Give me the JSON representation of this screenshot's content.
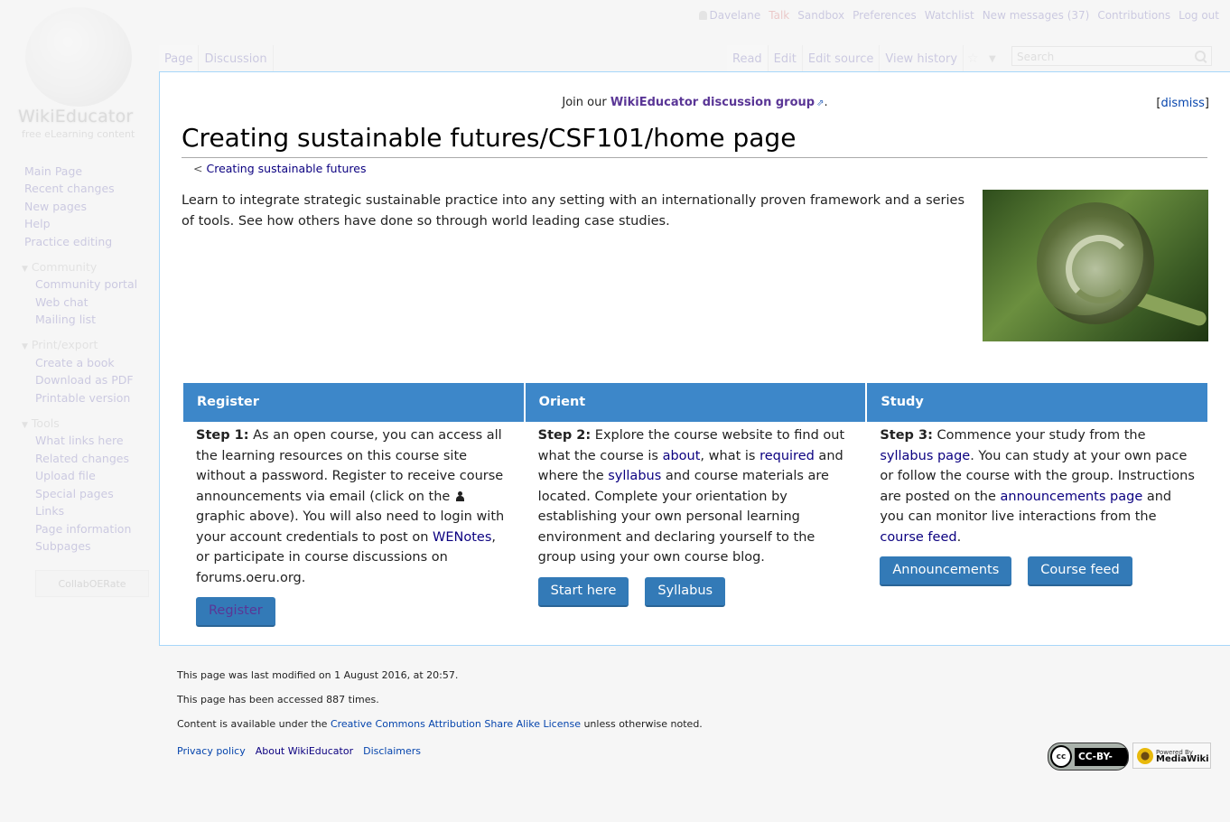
{
  "logo": {
    "wordmark": "WikiEducator",
    "tagline": "free eLearning content"
  },
  "personal": [
    {
      "label": "Davelane",
      "kind": "user"
    },
    {
      "label": "Talk",
      "kind": "talk"
    },
    {
      "label": "Sandbox"
    },
    {
      "label": "Preferences"
    },
    {
      "label": "Watchlist"
    },
    {
      "label": "New messages (37)"
    },
    {
      "label": "Contributions"
    },
    {
      "label": "Log out"
    }
  ],
  "tabs": {
    "left": [
      "Page",
      "Discussion"
    ],
    "right": [
      "Read",
      "Edit",
      "Edit source",
      "View history"
    ],
    "star_glyph": "☆",
    "more_glyph": "▼"
  },
  "search": {
    "placeholder": "Search"
  },
  "sidebar": {
    "main": [
      "Main Page",
      "Recent changes",
      "New pages",
      "Help",
      "Practice editing"
    ],
    "portals": [
      {
        "heading": "Community",
        "items": [
          "Community portal",
          "Web chat",
          "Mailing list"
        ]
      },
      {
        "heading": "Print/export",
        "items": [
          "Create a book",
          "Download as PDF",
          "Printable version"
        ]
      },
      {
        "heading": "Tools",
        "items": [
          "What links here",
          "Related changes",
          "Upload file",
          "Special pages",
          "Links",
          "Page information",
          "Subpages"
        ]
      }
    ],
    "collab_button": "CollabOERate"
  },
  "sitenotice": {
    "prefix": "Join our ",
    "link": "WikiEducator discussion group",
    "suffix": ".",
    "dismiss": "dismiss"
  },
  "page": {
    "title": "Creating sustainable futures/CSF101/home page",
    "subpage_sep": "<",
    "subpage_link": "Creating sustainable futures",
    "intro": "Learn to integrate strategic sustainable practice into any setting with an internationally proven framework and a series of tools. See how others have done so through world leading case studies."
  },
  "columns": {
    "register": {
      "heading": "Register",
      "step": "Step 1:",
      "t1": " As an open course, you can access all the learning resources on this course site without a password. Register to receive course announcements via email (click on the ",
      "t2": " graphic above). You will also need to login with your account credentials to post on ",
      "wenotes": "WENotes",
      "t3": ", or participate in course discussions on forums.oeru.org.",
      "button": "Register"
    },
    "orient": {
      "heading": "Orient",
      "step": "Step 2:",
      "t1": " Explore the course website to find out what the course is ",
      "about": "about",
      "t2": ", what is ",
      "required": "required",
      "t3": " and where the ",
      "syllabus": "syllabus",
      "t4": " and course materials are located. Complete your orientation by establishing your own personal learning environment and declaring yourself to the group using your own course blog.",
      "button1": "Start here",
      "button2": "Syllabus"
    },
    "study": {
      "heading": "Study",
      "step": "Step 3:",
      "t1": " Commence your study from the ",
      "syllabus_page": "syllabus page",
      "t2": ". You can study at your own pace or follow the course with the group. Instructions are posted on the ",
      "announcements_page": "announcements page",
      "t3": " and you can monitor live interactions from the ",
      "course_feed": "course feed",
      "t4": ".",
      "button1": "Announcements",
      "button2": "Course feed"
    }
  },
  "footer": {
    "lastmod": "This page was last modified on 1 August 2016, at 20:57.",
    "views": "This page has been accessed 887 times.",
    "license_prefix": "Content is available under the ",
    "license_link": "Creative Commons Attribution Share Alike License",
    "license_suffix": " unless otherwise noted.",
    "places": [
      "Privacy policy",
      "About WikiEducator",
      "Disclaimers"
    ],
    "cc_badge": {
      "circle": "cc",
      "text": "CC-BY-SA"
    },
    "mw_badge": {
      "line1": "Powered By",
      "line2": "MediaWiki"
    }
  },
  "colors": {
    "accent": "#3d87c9",
    "button": "#337ab7",
    "link": "#0b0080",
    "visited": "#5a3696",
    "border": "#a7d7f9"
  }
}
